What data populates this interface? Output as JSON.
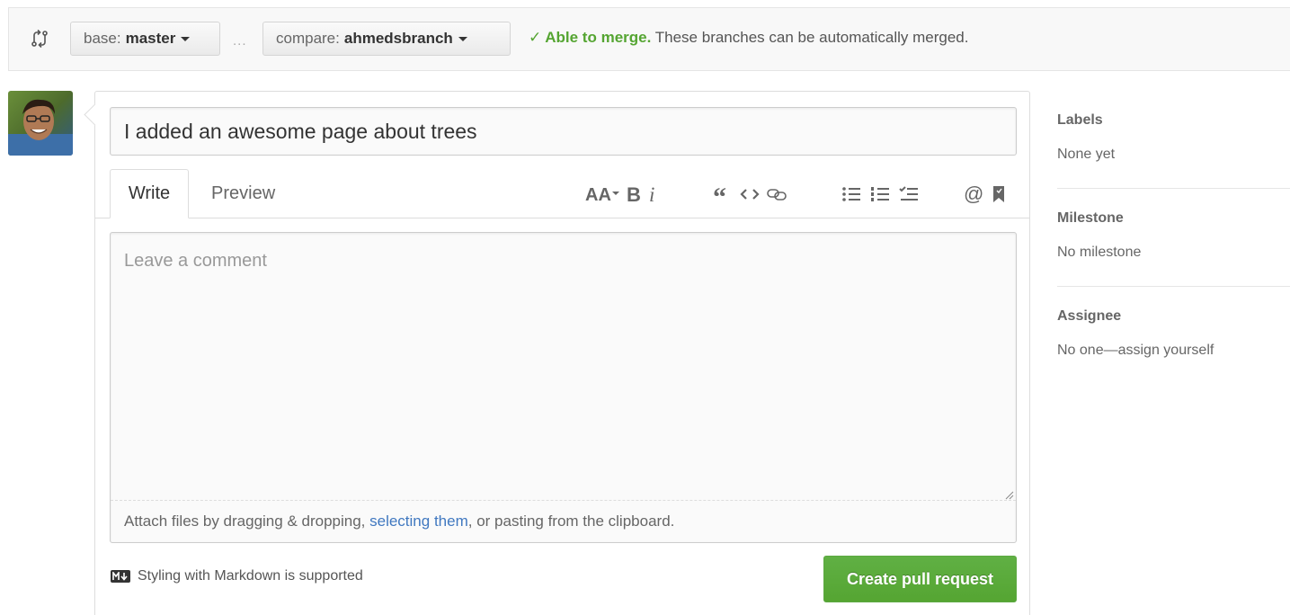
{
  "compare": {
    "base_label": "base:",
    "base_branch": "master",
    "ellipsis": "...",
    "compare_label": "compare:",
    "compare_branch": "ahmedsbranch",
    "merge_ok": "Able to merge.",
    "merge_message": "These branches can be automatically merged.",
    "ok_color": "#55a532"
  },
  "pr_form": {
    "title_value": "I added an awesome page about trees",
    "tabs": [
      {
        "label": "Write",
        "active": true
      },
      {
        "label": "Preview",
        "active": false
      }
    ],
    "toolbar_icons": [
      "text-size-icon",
      "bold-icon",
      "italic-icon",
      "quote-icon",
      "code-icon",
      "link-icon",
      "bullet-list-icon",
      "numbered-list-icon",
      "task-list-icon",
      "mention-icon",
      "bookmark-icon"
    ],
    "comment_placeholder": "Leave a comment",
    "attach_before": "Attach files by dragging & dropping, ",
    "attach_link": "selecting them",
    "attach_after": ", or pasting from the clipboard.",
    "markdown_note": "Styling with Markdown is supported",
    "submit_label": "Create pull request",
    "submit_color": "#55a532"
  },
  "sidebar": {
    "sections": [
      {
        "heading": "Labels",
        "value": "None yet"
      },
      {
        "heading": "Milestone",
        "value": "No milestone"
      },
      {
        "heading": "Assignee",
        "value": "No one—assign yourself"
      }
    ]
  }
}
